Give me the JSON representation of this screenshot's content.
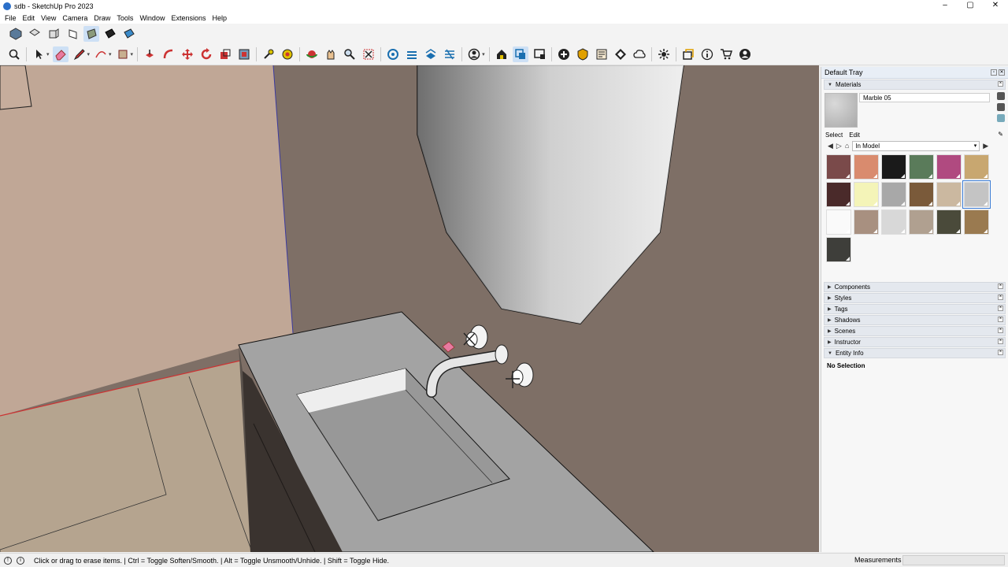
{
  "window": {
    "title": "sdb - SketchUp Pro 2023",
    "controls": [
      "–",
      "▢",
      "✕"
    ]
  },
  "menu": [
    "File",
    "Edit",
    "View",
    "Camera",
    "Draw",
    "Tools",
    "Window",
    "Extensions",
    "Help"
  ],
  "toolbar_views": [
    "iso-view",
    "top-view",
    "front-view",
    "right-view",
    "back-view",
    "left-view",
    "bottom-view"
  ],
  "toolbar_tools": [
    "zoom-extents",
    "select",
    "eraser",
    "pencil-line",
    "arc",
    "rectangle",
    "push-pull",
    "follow-me",
    "move",
    "rotate",
    "scale",
    "offset",
    "tape-measure",
    "paint-bucket",
    "orbit",
    "pan",
    "zoom",
    "zoom-window",
    "section-plane",
    "section-cuts",
    "section-fill",
    "display-section",
    "user-account",
    "warehouse",
    "layout",
    "extension-manager",
    "send-to-layout",
    "export",
    "add-location",
    "generate-report",
    "add-match-photo",
    "trimble-connect",
    "extension-warehouse",
    "window-panels",
    "info",
    "shop",
    "profile"
  ],
  "tray": {
    "title": "Default Tray",
    "materials": {
      "header": "Materials",
      "current_name": "Marble 05",
      "tabs": {
        "select": "Select",
        "edit": "Edit"
      },
      "library": "In Model",
      "swatch_colors": [
        "#7a4a4a",
        "#d98b6e",
        "#1a1a1a",
        "#5a7b5a",
        "#b04a80",
        "#c8a770",
        "#4a2a2a",
        "#f4f4b8",
        "#a8a8a8",
        "#7a5a3a",
        "#cbb8a0",
        "#c4c4c4",
        "#fafafa",
        "#a89080",
        "#d8d8d8",
        "#b0a090",
        "#4a4a3a",
        "#9a7a50",
        "#3e3e3a"
      ],
      "selected_index": 11
    },
    "panels": [
      "Components",
      "Styles",
      "Tags",
      "Shadows",
      "Scenes",
      "Instructor"
    ],
    "entity_info": {
      "header": "Entity Info",
      "value": "No Selection"
    }
  },
  "status": {
    "message": "Click or drag to erase items. | Ctrl = Toggle Soften/Smooth. | Alt = Toggle Unsmooth/Unhide. | Shift = Toggle Hide.",
    "measurements_label": "Measurements",
    "measurements_value": ""
  },
  "colors": {
    "wall": "#7e6f66",
    "left_wall": "#c0a796",
    "floor": "#b5a48f",
    "counter_top": "#a3a3a3",
    "mirror": "#d8d8d8",
    "cabinet": "#3a332f"
  }
}
